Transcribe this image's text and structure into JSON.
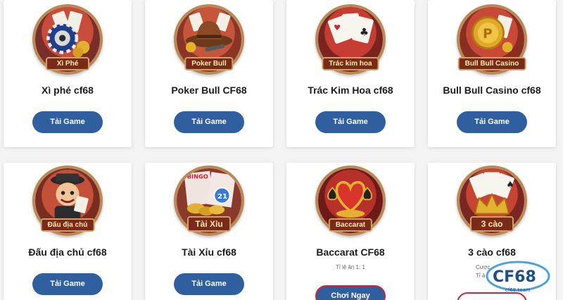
{
  "cards": [
    {
      "icon_label": "Xì Phé",
      "title": "Xì phé cf68",
      "button": "Tải Game",
      "icon": "poker-chip-cards-icon"
    },
    {
      "icon_label": "Poker Bull",
      "title": "Poker Bull CF68",
      "button": "Tải Game",
      "icon": "cowboy-hat-revolver-icon"
    },
    {
      "icon_label": "Trác kim hoa",
      "title": "Trác Kim Hoa cf68",
      "button": "Tải Game",
      "icon": "playing-cards-icon"
    },
    {
      "icon_label": "Bull Bull Casino",
      "title": "Bull Bull Casino cf68",
      "button": "Tải Game",
      "icon": "gold-coin-cards-icon"
    },
    {
      "icon_label": "Đấu địa chủ",
      "title": "Đấu địa chủ cf68",
      "button": "Tải Game",
      "icon": "landlord-character-icon"
    },
    {
      "icon_label": "Tài Xỉu",
      "title": "Tài Xỉu cf68",
      "button": "Tải Game",
      "icon": "bingo-coins-icon"
    },
    {
      "icon_label": "Baccarat",
      "title": "Baccarat CF68",
      "subtitle": "Tỉ lệ ăn 1: 1",
      "button": "Chơi Ngay",
      "icon": "heart-spade-chips-icon"
    },
    {
      "icon_label": "3 cào",
      "title": "3 cào cf68",
      "subtitle_a": "Cược",
      "subtitle_b": "Tỉ ả",
      "icon": "crown-cards-icon"
    }
  ],
  "bingo_text": "BINGO",
  "bingo_ball": "21",
  "logo_text": "CF68",
  "logo_sub": "cf68.team",
  "colors": {
    "button": "#2f5f9e",
    "ribbon": "#7a2a18",
    "ring": "#b98a58",
    "play_border": "#c4293b"
  }
}
